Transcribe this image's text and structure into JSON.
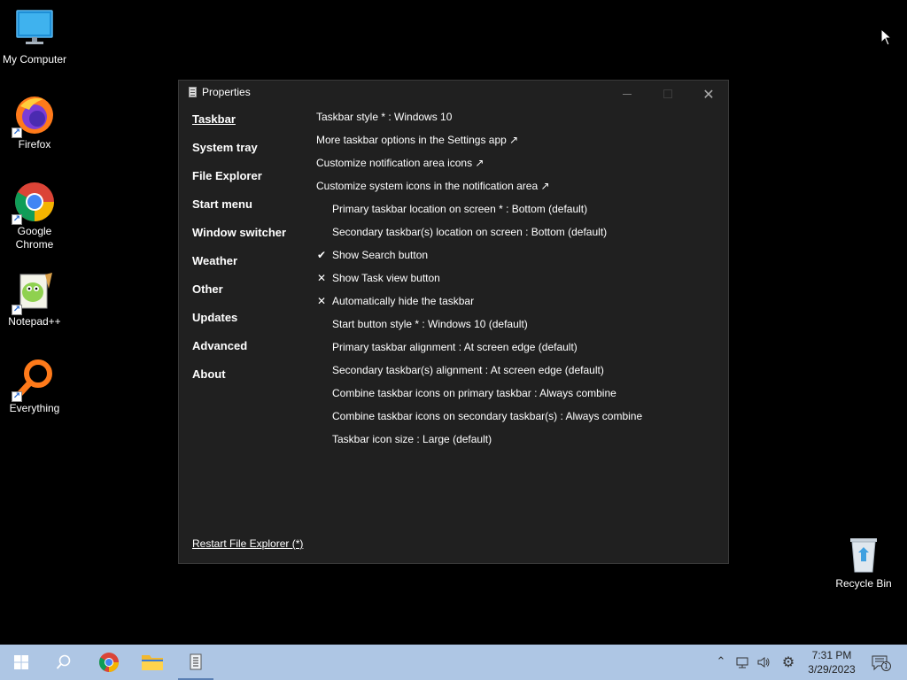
{
  "desktop": {
    "icons": [
      {
        "label": "My Computer"
      },
      {
        "label": "Firefox"
      },
      {
        "label": "Google Chrome"
      },
      {
        "label": "Notepad++"
      },
      {
        "label": "Everything"
      },
      {
        "label": "Recycle Bin"
      }
    ]
  },
  "window": {
    "title": "Properties",
    "nav": [
      "Taskbar",
      "System tray",
      "File Explorer",
      "Start menu",
      "Window switcher",
      "Weather",
      "Other",
      "Updates",
      "Advanced",
      "About"
    ],
    "active_nav": "Taskbar",
    "options": [
      {
        "text": "Taskbar style * : Windows 10",
        "mark": ""
      },
      {
        "text": "More taskbar options in the Settings app ↗",
        "mark": ""
      },
      {
        "text": "Customize notification area icons ↗",
        "mark": ""
      },
      {
        "text": "Customize system icons in the notification area ↗",
        "mark": ""
      },
      {
        "text": "Primary taskbar location on screen * : Bottom (default)",
        "mark": ""
      },
      {
        "text": "Secondary taskbar(s) location on screen : Bottom (default)",
        "mark": ""
      },
      {
        "text": "Show Search button",
        "mark": "✔"
      },
      {
        "text": "Show Task view button",
        "mark": "✕"
      },
      {
        "text": "Automatically hide the taskbar",
        "mark": "✕"
      },
      {
        "text": "Start button style * : Windows 10 (default)",
        "mark": ""
      },
      {
        "text": "Primary taskbar alignment : At screen edge (default)",
        "mark": ""
      },
      {
        "text": "Secondary taskbar(s) alignment : At screen edge (default)",
        "mark": ""
      },
      {
        "text": "Combine taskbar icons on primary taskbar : Always combine",
        "mark": ""
      },
      {
        "text": "Combine taskbar icons on secondary taskbar(s) : Always combine",
        "mark": ""
      },
      {
        "text": "Taskbar icon size : Large (default)",
        "mark": ""
      }
    ],
    "restart_link": "Restart File Explorer (*)"
  },
  "taskbar": {
    "time": "7:31 PM",
    "date": "3/29/2023",
    "notification_count": "1"
  }
}
